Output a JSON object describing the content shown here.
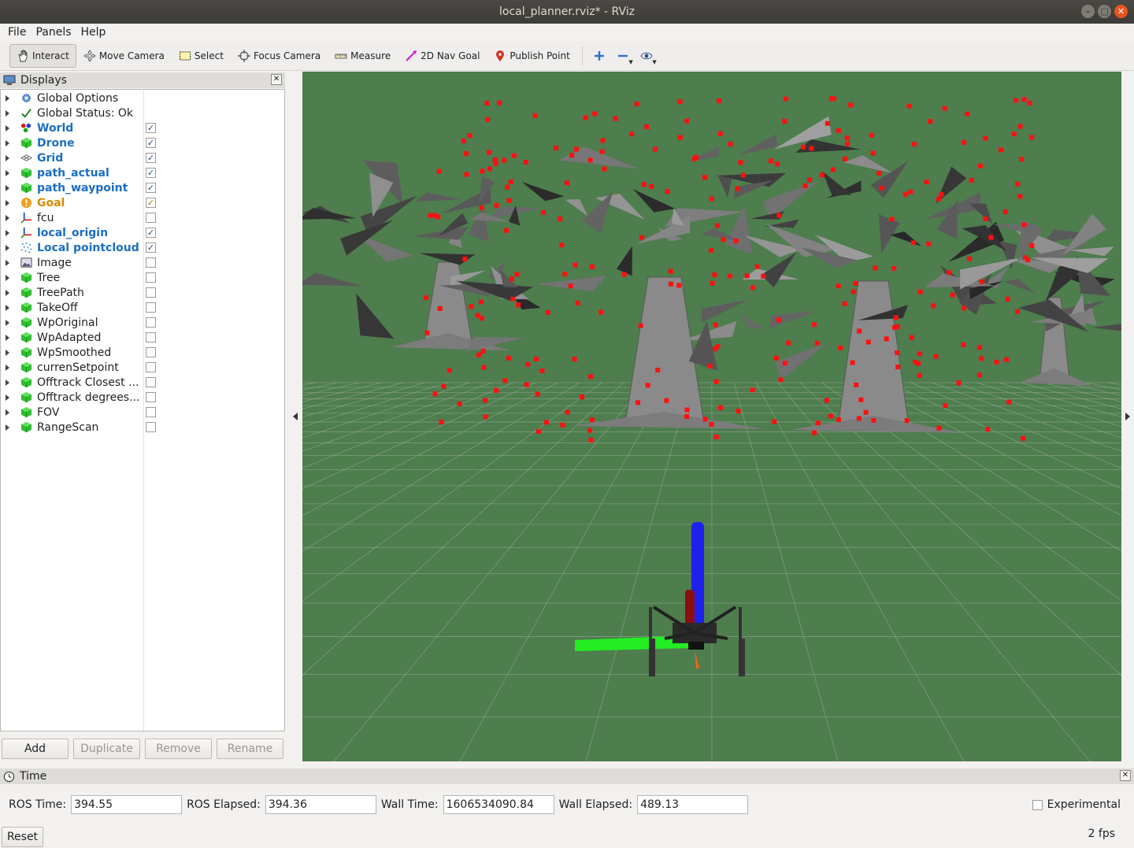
{
  "window": {
    "title": "local_planner.rviz* - RViz"
  },
  "menu": [
    "File",
    "Panels",
    "Help"
  ],
  "toolbar": {
    "interact": "Interact",
    "move_camera": "Move Camera",
    "select": "Select",
    "focus_camera": "Focus Camera",
    "measure": "Measure",
    "nav_goal": "2D Nav Goal",
    "publish_point": "Publish Point"
  },
  "displays": {
    "title": "Displays",
    "items": [
      {
        "label": "Global Options",
        "icon": "gear-icon",
        "style": "normal",
        "checked": null
      },
      {
        "label": "Global Status: Ok",
        "icon": "check-icon",
        "style": "normal",
        "checked": null
      },
      {
        "label": "World",
        "icon": "world-icon",
        "style": "bold",
        "checked": true
      },
      {
        "label": "Drone",
        "icon": "cube-icon",
        "style": "bold",
        "checked": true
      },
      {
        "label": "Grid",
        "icon": "grid-icon",
        "style": "bold",
        "checked": true
      },
      {
        "label": "path_actual",
        "icon": "cube-icon",
        "style": "bold",
        "checked": true
      },
      {
        "label": "path_waypoint",
        "icon": "cube-icon",
        "style": "bold",
        "checked": true
      },
      {
        "label": "Goal",
        "icon": "warning-icon",
        "style": "goal",
        "checked": true
      },
      {
        "label": "fcu",
        "icon": "axes-icon",
        "style": "normal",
        "checked": false
      },
      {
        "label": "local_origin",
        "icon": "axes-icon",
        "style": "bold",
        "checked": true
      },
      {
        "label": "Local pointcloud",
        "icon": "pointcloud-icon",
        "style": "bold",
        "checked": true
      },
      {
        "label": "Image",
        "icon": "image-icon",
        "style": "normal",
        "checked": false
      },
      {
        "label": "Tree",
        "icon": "cube-icon",
        "style": "normal",
        "checked": false
      },
      {
        "label": "TreePath",
        "icon": "cube-icon",
        "style": "normal",
        "checked": false
      },
      {
        "label": "TakeOff",
        "icon": "cube-icon",
        "style": "normal",
        "checked": false
      },
      {
        "label": "WpOriginal",
        "icon": "cube-icon",
        "style": "normal",
        "checked": false
      },
      {
        "label": "WpAdapted",
        "icon": "cube-icon",
        "style": "normal",
        "checked": false
      },
      {
        "label": "WpSmoothed",
        "icon": "cube-icon",
        "style": "normal",
        "checked": false
      },
      {
        "label": "currenSetpoint",
        "icon": "cube-icon",
        "style": "normal",
        "checked": false
      },
      {
        "label": "Offtrack Closest ...",
        "icon": "cube-icon",
        "style": "normal",
        "checked": false
      },
      {
        "label": "Offtrack degrees...",
        "icon": "cube-icon",
        "style": "normal",
        "checked": false
      },
      {
        "label": "FOV",
        "icon": "cube-icon",
        "style": "normal",
        "checked": false
      },
      {
        "label": "RangeScan",
        "icon": "cube-icon",
        "style": "normal",
        "checked": false
      }
    ],
    "buttons": {
      "add": "Add",
      "duplicate": "Duplicate",
      "remove": "Remove",
      "rename": "Rename"
    }
  },
  "viewport": {
    "background": "#4e7d4e"
  },
  "time": {
    "title": "Time",
    "ros_time_label": "ROS Time:",
    "ros_time": "394.55",
    "ros_elapsed_label": "ROS Elapsed:",
    "ros_elapsed": "394.36",
    "wall_time_label": "Wall Time:",
    "wall_time": "1606534090.84",
    "wall_elapsed_label": "Wall Elapsed:",
    "wall_elapsed": "489.13",
    "experimental": "Experimental",
    "reset": "Reset",
    "fps": "2 fps"
  }
}
